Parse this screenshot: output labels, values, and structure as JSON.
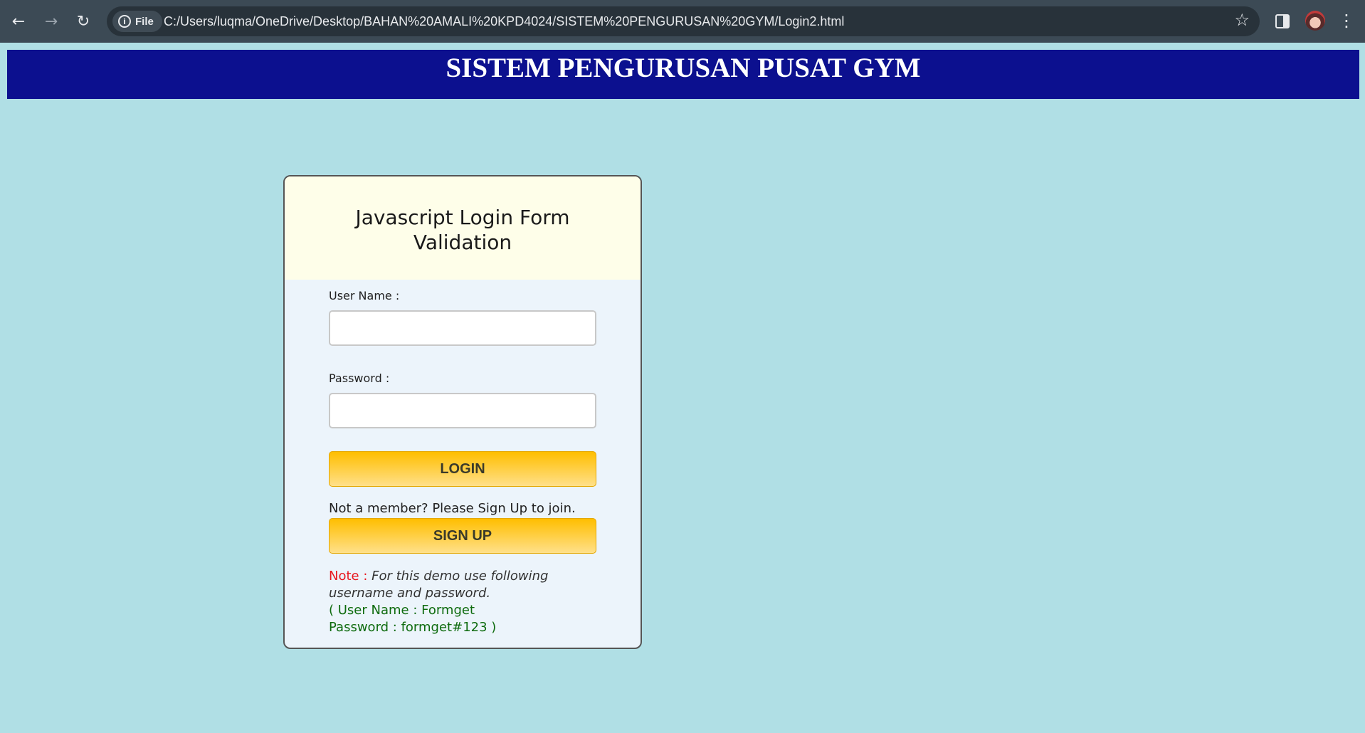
{
  "browser": {
    "site_chip_label": "File",
    "url": "C:/Users/luqma/OneDrive/Desktop/BAHAN%20AMALI%20KPD4024/SISTEM%20PENGURUSAN%20GYM/Login2.html",
    "icons": [
      "back-arrow-icon",
      "forward-arrow-icon",
      "reload-icon",
      "info-icon",
      "star-icon",
      "side-panel-icon",
      "profile-avatar",
      "menu-icon"
    ]
  },
  "page": {
    "banner_title": "SISTEM PENGURUSAN PUSAT GYM",
    "background_color": "#b0dfe5",
    "banner_color": "#0c108f"
  },
  "login_card": {
    "title_line1": "Javascript Login Form",
    "title_line2": "Validation",
    "username_label": "User Name :",
    "username_value": "",
    "password_label": "Password :",
    "password_value": "",
    "login_button": "LOGIN",
    "member_prompt": "Not a member? Please Sign Up to join.",
    "signup_button": "SIGN UP",
    "note_label": "Note :",
    "note_text": "For this demo use following username and password.",
    "credentials_line1": "( User Name : Formget",
    "credentials_line2": "Password : formget#123 )"
  }
}
